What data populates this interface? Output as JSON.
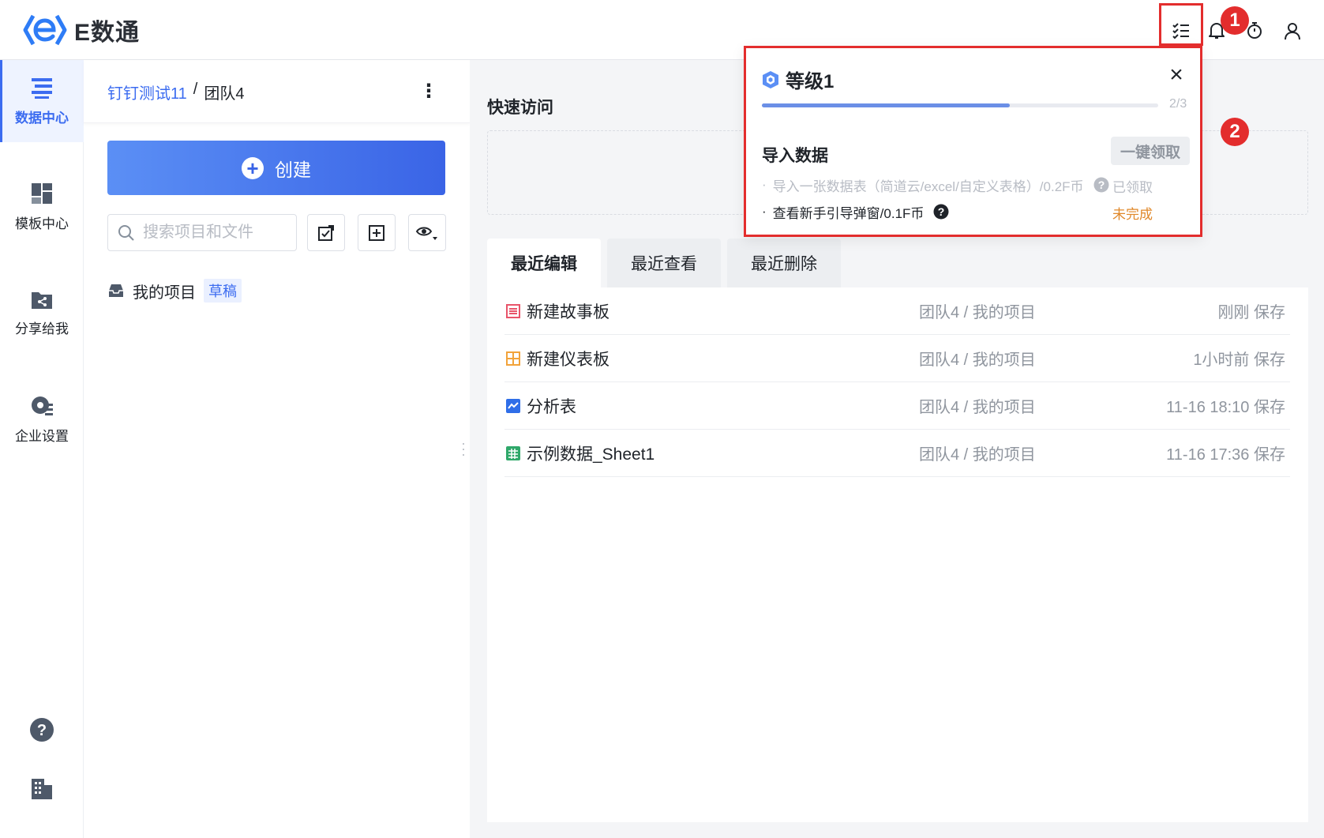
{
  "app": {
    "brand": "E数通",
    "accent": "#3c6cf0",
    "highlight": "#e32d2d"
  },
  "header": {
    "icons": [
      "task-list-icon",
      "bell-icon",
      "timer-icon",
      "user-icon"
    ]
  },
  "leftnav": {
    "items": [
      {
        "label": "数据中心",
        "icon": "data-center-icon",
        "active": true
      },
      {
        "label": "模板中心",
        "icon": "template-icon",
        "active": false
      },
      {
        "label": "分享给我",
        "icon": "share-icon",
        "active": false
      },
      {
        "label": "企业设置",
        "icon": "settings-icon",
        "active": false
      }
    ],
    "bottom_icons": [
      "help-icon",
      "building-icon"
    ]
  },
  "panel": {
    "breadcrumb": {
      "parent": "钉钉测试11",
      "sep": "/",
      "current": "团队4"
    },
    "create_label": "创建",
    "search_placeholder": "搜索项目和文件",
    "project": {
      "label": "我的项目",
      "tag": "草稿"
    }
  },
  "main": {
    "quick_access_title": "快速访问",
    "tabs": [
      "最近编辑",
      "最近查看",
      "最近删除"
    ],
    "rows": [
      {
        "name": "新建故事板",
        "path": "团队4 / 我的项目",
        "time": "刚刚 保存",
        "icon": "storyboard-icon",
        "color": "#e8546a"
      },
      {
        "name": "新建仪表板",
        "path": "团队4 / 我的项目",
        "time": "1小时前 保存",
        "icon": "dashboard-icon",
        "color": "#f2a33a"
      },
      {
        "name": "分析表",
        "path": "团队4 / 我的项目",
        "time": "11-16 18:10 保存",
        "icon": "analysis-icon",
        "color": "#2f6ee8"
      },
      {
        "name": "示例数据_Sheet1",
        "path": "团队4 / 我的项目",
        "time": "11-16 17:36 保存",
        "icon": "sheet-icon",
        "color": "#2fa86a"
      }
    ]
  },
  "popup": {
    "level_title": "等级1",
    "progress_text": "2/3",
    "progress_fraction": 0.625,
    "task_title": "导入数据",
    "claim_label": "一键领取",
    "tasks": [
      {
        "text": "导入一张数据表（简道云/excel/自定义表格）/0.2F币",
        "status": "已领取",
        "done": true
      },
      {
        "text": "查看新手引导弹窗/0.1F币",
        "status": "未完成",
        "done": false
      }
    ],
    "status_color_pending": "#e0882a"
  },
  "annotations": {
    "one": "1",
    "two": "2"
  }
}
